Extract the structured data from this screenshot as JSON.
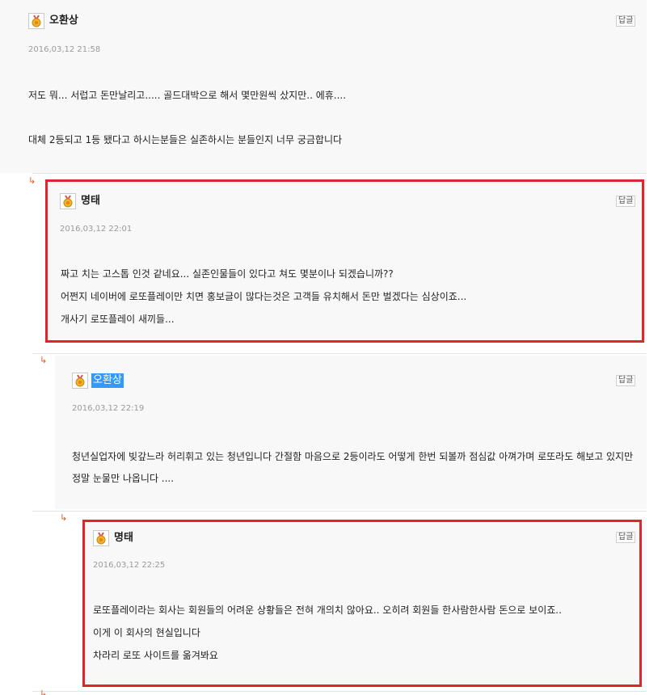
{
  "reply_arrow": "↳",
  "reply_label": "답글",
  "accent_color": "#e0262d",
  "comments": [
    {
      "author": "오환상",
      "date": "2016,03,12 21:58",
      "lines": [
        "저도 뭐... 서럽고 돈만날리고..... 골드대박으로 해서 몇만원씩 샀지만.. 에휴....",
        "대체 2등되고 1등 됐다고 하시는분들은 실존하시는 분들인지 너무 궁금합니다"
      ]
    },
    {
      "author": "명태",
      "date": "2016,03,12 22:01",
      "lines": [
        "짜고 치는 고스톱 인것 같네요... 실존인물들이 있다고 쳐도 몇분이나 되겠습니까??",
        "어쩐지 네이버에 로또플레이만 치면 홍보글이 많다는것은 고객들 유치해서 돈만 벌겠다는 심상이죠...",
        "개사기 로또플레이 새끼들..."
      ]
    },
    {
      "author": "오환상",
      "date": "2016,03,12 22:19",
      "lines": [
        "청년실업자에 빚갚느라 허리휘고 있는 청년입니다 간절함 마음으로 2등이라도 어떻게 한번 되볼까 점심값 아껴가며 로또라도 해보고 있지만 정말 눈물만 나옵니다 ...."
      ]
    },
    {
      "author": "명태",
      "date": "2016,03,12 22:25",
      "lines": [
        "로또플레이라는 회사는 회원들의 어려운 상황들은 전혀 개의치 않아요.. 오히려 회원들 한사람한사람 돈으로 보이죠..",
        "이게 이 회사의 현실입니다",
        "차라리 로또 사이트를 옮겨봐요"
      ]
    }
  ]
}
